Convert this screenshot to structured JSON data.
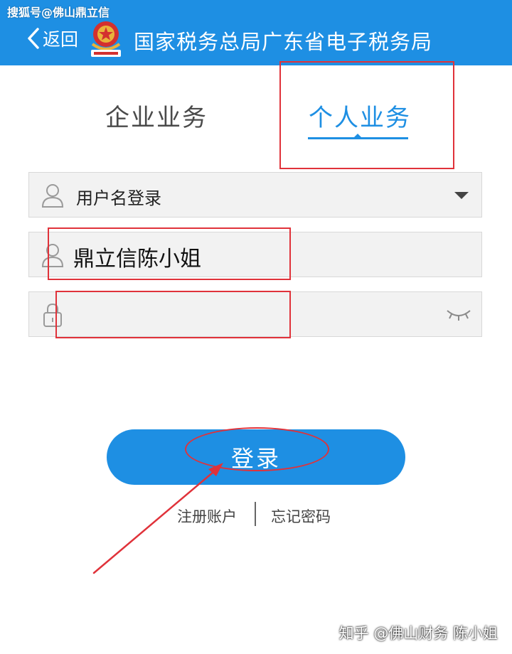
{
  "watermark_top": "搜狐号@佛山鼎立信",
  "header": {
    "back_label": "返回",
    "title": "国家税务总局广东省电子税务局"
  },
  "tabs": {
    "enterprise": "企业业务",
    "personal": "个人业务",
    "active": "personal"
  },
  "login_form": {
    "login_type": "用户名登录",
    "username_value": "鼎立信陈小姐",
    "password_value": ""
  },
  "login_button": "登录",
  "links": {
    "register": "注册账户",
    "forgot": "忘记密码"
  },
  "watermark_bottom": "知乎 @佛山财务 陈小姐",
  "colors": {
    "brand_blue": "#1e8fe3",
    "annotation_red": "#e0323a",
    "field_bg": "#f2f2f2"
  },
  "icons": {
    "back": "chevron-left-icon",
    "emblem": "tax-emblem-icon",
    "user": "user-icon",
    "lock": "lock-icon",
    "eye": "eye-closed-icon",
    "dropdown": "caret-down-icon"
  }
}
